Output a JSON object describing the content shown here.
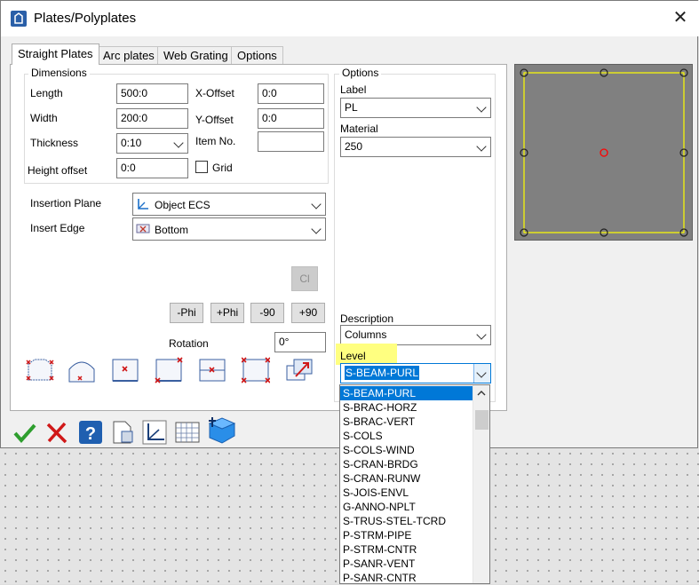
{
  "window": {
    "title": "Plates/Polyplates",
    "close_symbol": "✕"
  },
  "tabs": [
    {
      "label": "Straight Plates",
      "active": true
    },
    {
      "label": "Arc plates"
    },
    {
      "label": "Web Grating"
    },
    {
      "label": "Options"
    }
  ],
  "dimensions": {
    "title": "Dimensions",
    "length_label": "Length",
    "length_value": "500:0",
    "width_label": "Width",
    "width_value": "200:0",
    "thickness_label": "Thickness",
    "thickness_value": "0:10",
    "height_offset_label": "Height offset",
    "height_offset_value": "0:0",
    "xoffset_label": "X-Offset",
    "xoffset_value": "0:0",
    "yoffset_label": "Y-Offset",
    "yoffset_value": "0:0",
    "itemno_label": "Item No.",
    "itemno_value": "",
    "grid_label": "Grid",
    "grid_checked": false
  },
  "insertion": {
    "plane_label": "Insertion Plane",
    "plane_value": "Object ECS",
    "edge_label": "Insert Edge",
    "edge_value": "Bottom"
  },
  "buttons": {
    "cl_label": "Cl",
    "minus_phi": "-Phi",
    "plus_phi": "+Phi",
    "minus_90": "-90",
    "plus_90": "+90"
  },
  "rotation": {
    "label": "Rotation",
    "value": "0°"
  },
  "options": {
    "title": "Options",
    "label_label": "Label",
    "label_value": "PL",
    "material_label": "Material",
    "material_value": "250",
    "description_label": "Description",
    "description_value": "Columns",
    "level_label": "Level",
    "level_value": "S-BEAM-PURL"
  },
  "level_dropdown": {
    "items": [
      "S-BEAM-PURL",
      "S-BRAC-HORZ",
      "S-BRAC-VERT",
      "S-COLS",
      "S-COLS-WIND",
      "S-CRAN-BRDG",
      "S-CRAN-RUNW",
      "S-JOIS-ENVL",
      "G-ANNO-NPLT",
      "S-TRUS-STEL-TCRD",
      "P-STRM-PIPE",
      "P-STRM-CNTR",
      "P-SANR-VENT",
      "P-SANR-CNTR"
    ],
    "selected_index": 0
  },
  "colors": {
    "highlight": "#ffff80",
    "selection": "#0078d7",
    "preview_bg": "#808080",
    "preview_outline": "#ffff00",
    "center_mark": "#ff0000"
  }
}
